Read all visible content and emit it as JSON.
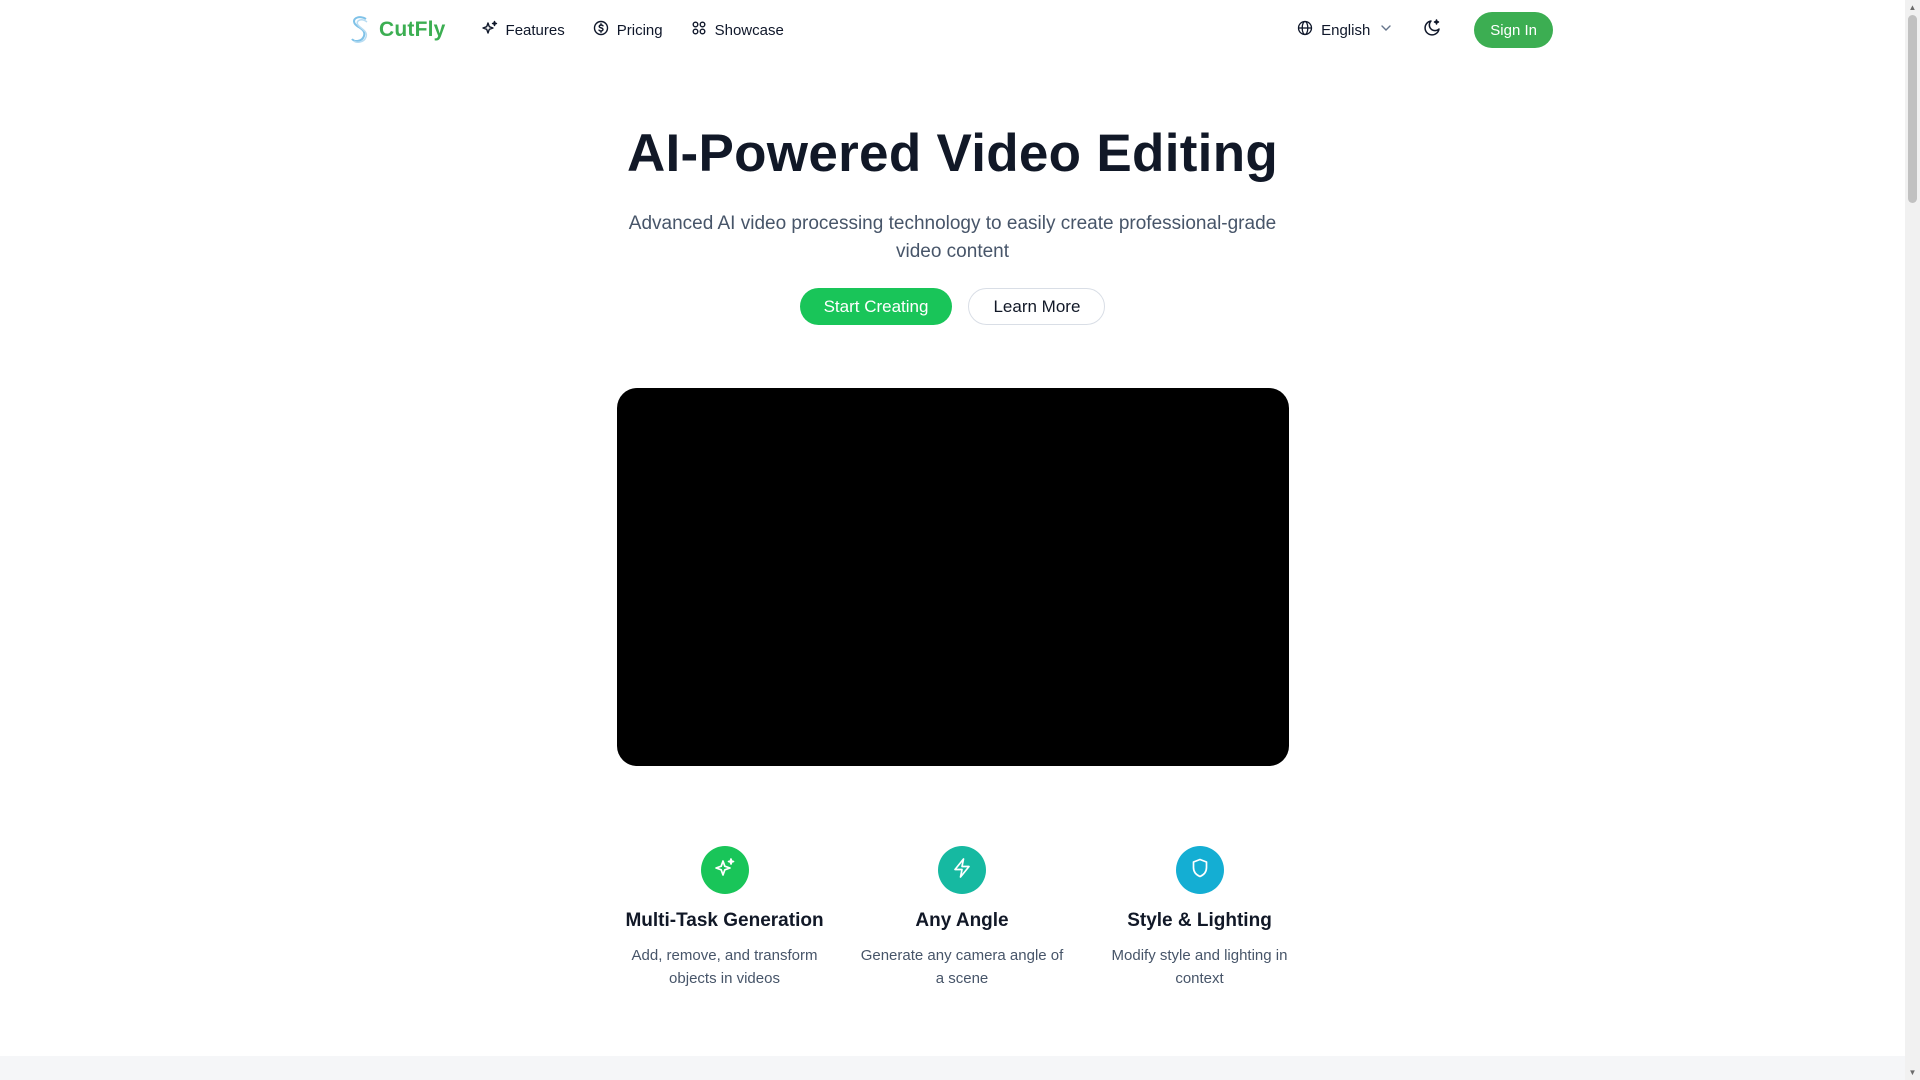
{
  "brand": {
    "name": "CutFly",
    "logo_icon": "s-swoosh-logo-icon",
    "color": "#3cae52"
  },
  "nav": {
    "links": [
      {
        "label": "Features",
        "icon": "sparkles-icon"
      },
      {
        "label": "Pricing",
        "icon": "dollar-circle-icon"
      },
      {
        "label": "Showcase",
        "icon": "grid-icon"
      }
    ],
    "language": {
      "label": "English",
      "icon": "globe-icon"
    },
    "theme_icon": "moon-sparkle-icon",
    "signin_label": "Sign In"
  },
  "hero": {
    "title": "AI-Powered Video Editing",
    "subtitle": "Advanced AI video processing technology to easily create professional-grade video content",
    "primary_button": "Start Creating",
    "secondary_button": "Learn More",
    "accent": "#19c559"
  },
  "features": [
    {
      "title": "Multi-Task Generation",
      "description": "Add, remove, and transform objects in videos",
      "icon": "sparkles-icon",
      "color": "#19c559"
    },
    {
      "title": "Any Angle",
      "description": "Generate any camera angle of a scene",
      "icon": "lightning-icon",
      "color": "#16b9a1"
    },
    {
      "title": "Style & Lighting",
      "description": "Modify style and lighting in context",
      "icon": "shield-icon",
      "color": "#14aed3"
    }
  ]
}
